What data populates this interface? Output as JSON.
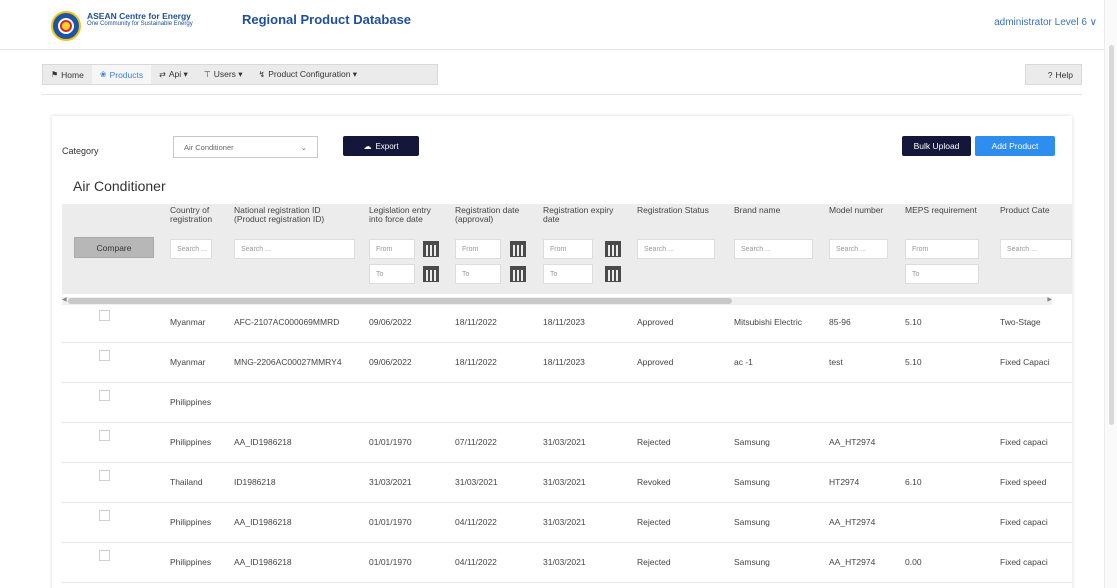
{
  "header": {
    "org_name": "ASEAN Centre for Energy",
    "org_tagline": "One Community for Sustainable Energy",
    "app_title": "Regional Product Database",
    "user_menu": "administrator Level 6 ∨"
  },
  "nav": {
    "home": "Home",
    "products": "Products",
    "api": "Api ▾",
    "users": "Users ▾",
    "product_configuration": "Product Configuration ▾",
    "help": "Help"
  },
  "toolbar": {
    "category_label": "Category",
    "category_value": "Air Conditioner",
    "export_label": "Export",
    "bulk_upload_label": "Bulk Upload",
    "add_product_label": "Add Product"
  },
  "section_title": "Air Conditioner",
  "table": {
    "compare_label": "Compare",
    "columns": [
      "Country of registration",
      "National registration ID (Product registration ID)",
      "Legislation entry into force date",
      "Registration date (approval)",
      "Registration expiry date",
      "Registration Status",
      "Brand name",
      "Model number",
      "MEPS requirement",
      "Product Cate"
    ],
    "placeholders": {
      "search": "Search ...",
      "from": "From",
      "to": "To"
    },
    "rows": [
      [
        "Myanmar",
        "AFC-2107AC000069MMRD",
        "09/06/2022",
        "18/11/2022",
        "18/11/2023",
        "Approved",
        "Mitsubishi Electric",
        "85-96",
        "5.10",
        "Two-Stage"
      ],
      [
        "Myanmar",
        "MNG-2206AC00027MMRY4",
        "09/06/2022",
        "18/11/2022",
        "18/11/2023",
        "Approved",
        "ac -1",
        "test",
        "5.10",
        "Fixed Capaci"
      ],
      [
        "Philippines",
        "",
        "",
        "",
        "",
        "",
        "",
        "",
        "",
        ""
      ],
      [
        "Philippines",
        "AA_ID1986218",
        "01/01/1970",
        "07/11/2022",
        "31/03/2021",
        "Rejected",
        "Samsung",
        "AA_HT2974",
        "",
        "Fixed capaci"
      ],
      [
        "Thailand",
        "ID1986218",
        "31/03/2021",
        "31/03/2021",
        "31/03/2021",
        "Revoked",
        "Samsung",
        "HT2974",
        "6.10",
        "Fixed speed"
      ],
      [
        "Philippines",
        "AA_ID1986218",
        "01/01/1970",
        "04/11/2022",
        "31/03/2021",
        "Rejected",
        "Samsung",
        "AA_HT2974",
        "",
        "Fixed capaci"
      ],
      [
        "Philippines",
        "AA_ID1986218",
        "01/01/1970",
        "04/11/2022",
        "31/03/2021",
        "Rejected",
        "Samsung",
        "AA_HT2974",
        "0.00",
        "Fixed capaci"
      ]
    ]
  }
}
